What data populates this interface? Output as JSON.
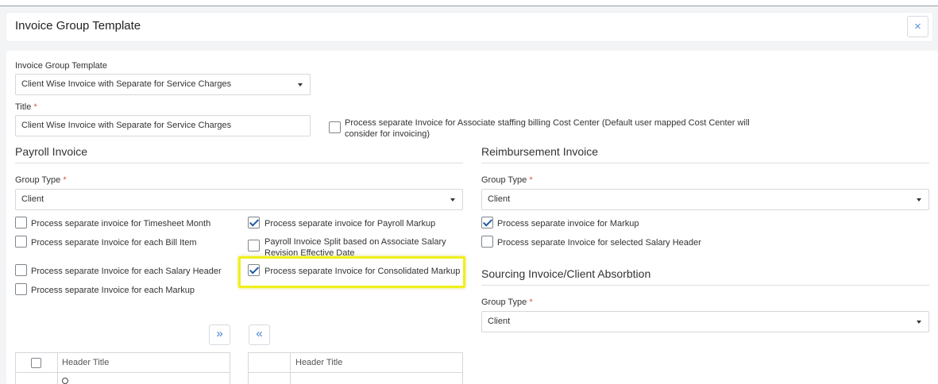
{
  "modal": {
    "title": "Invoice Group Template",
    "close_glyph": "×"
  },
  "template_select": {
    "label": "Invoice Group Template",
    "value": "Client Wise Invoice with Separate for Service Charges"
  },
  "title_field": {
    "label": "Title",
    "required_mark": "*",
    "value": "Client Wise Invoice with Separate for Service Charges"
  },
  "associate_option": {
    "line1": "Process separate Invoice for Associate staffing billing Cost Center (Default user mapped Cost Center will",
    "line2": "consider for invoicing)",
    "checked": false
  },
  "payroll": {
    "heading": "Payroll Invoice",
    "group_type_label": "Group Type",
    "required_mark": "*",
    "group_type_value": "Client",
    "options": {
      "timesheet_month": {
        "label": "Process separate invoice for Timesheet Month",
        "checked": false
      },
      "payroll_markup": {
        "label": "Process separate invoice for Payroll Markup",
        "checked": true
      },
      "each_bill_item": {
        "label": "Process separate Invoice for each Bill Item",
        "checked": false
      },
      "salary_revision_line1": "Payroll Invoice Split based on Associate Salary",
      "salary_revision_line2": "Revision Effective Date",
      "salary_revision_checked": false,
      "each_salary_header": {
        "label": "Process separate Invoice for each Salary Header",
        "checked": false
      },
      "consolidated_markup": {
        "label": "Process separate Invoice for Consolidated Markup",
        "checked": true
      },
      "each_markup": {
        "label": "Process separate Invoice for each Markup",
        "checked": false
      }
    },
    "move_right_glyph": "»",
    "move_left_glyph": "«",
    "left_table": {
      "header": "Header Title"
    },
    "right_table": {
      "header": "Header Title"
    }
  },
  "reimbursement": {
    "heading": "Reimbursement Invoice",
    "group_type_label": "Group Type",
    "required_mark": "*",
    "group_type_value": "Client",
    "options": {
      "markup": {
        "label": "Process separate invoice for Markup",
        "checked": true
      },
      "salary_header": {
        "label": "Process separate Invoice for selected Salary Header",
        "checked": false
      }
    }
  },
  "sourcing": {
    "heading": "Sourcing Invoice/Client Absorbtion",
    "group_type_label": "Group Type",
    "required_mark": "*",
    "group_type_value": "Client"
  },
  "colors": {
    "highlight": "#f0f01a",
    "check": "#1e5aa8",
    "accent": "#3f7fd6",
    "required": "#d9534f"
  },
  "icons": [
    "close-icon",
    "dropdown-caret-icon",
    "check-icon",
    "double-chevron-right-icon",
    "double-chevron-left-icon",
    "search-icon"
  ]
}
